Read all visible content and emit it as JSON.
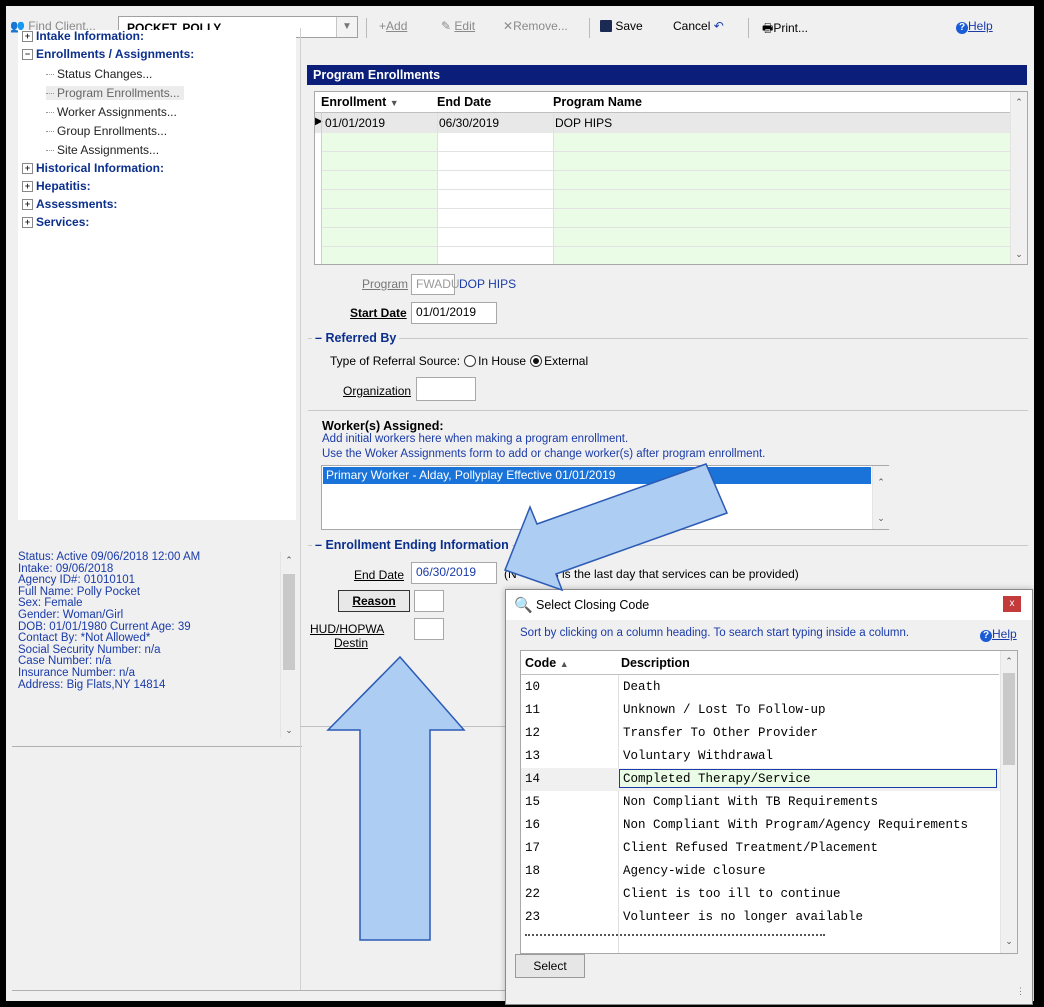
{
  "toolbar": {
    "find_client_label": "Find Client...",
    "client_name": "POCKET, POLLY",
    "add_label": "Add",
    "edit_label": "Edit",
    "remove_label": "Remove...",
    "save_label": "Save",
    "cancel_label": "Cancel",
    "print_label": "Print...",
    "help_label": "Help"
  },
  "tree": {
    "intake": "Intake Information:",
    "enrollments": "Enrollments / Assignments:",
    "children": [
      "Status Changes...",
      "Program Enrollments...",
      "Worker Assignments...",
      "Group Enrollments...",
      "Site Assignments..."
    ],
    "historical": "Historical Information:",
    "hepatitis": "Hepatitis:",
    "assessments": "Assessments:",
    "services": "Services:"
  },
  "client_info": [
    "Status: Active 09/06/2018 12:00 AM",
    "Intake: 09/06/2018",
    "Agency ID#: 01010101",
    "Full Name: Polly Pocket",
    "Sex: Female",
    "Gender: Woman/Girl",
    "DOB: 01/01/1980 Current Age: 39",
    "Contact By: *Not Allowed*",
    "Social Security Number: n/a",
    "Case Number: n/a",
    "Insurance Number: n/a",
    "Address: Big Flats,NY 14814"
  ],
  "program_enrollments": {
    "title": "Program Enrollments",
    "columns": [
      "Enrollment",
      "End Date",
      "Program Name"
    ],
    "rows": [
      {
        "enrollment": "01/01/2019",
        "end_date": "06/30/2019",
        "program": "DOP HIPS"
      }
    ]
  },
  "form": {
    "program_label": "Program",
    "program_code": "FWADU",
    "program_name": "DOP HIPS",
    "start_date_label": "Start Date",
    "start_date": "01/01/2019",
    "referred_by_title": "Referred By",
    "referral_source_label": "Type of Referral Source:",
    "in_house_label": "In House",
    "external_label": "External",
    "organization_label": "Organization",
    "workers_title": "Worker(s) Assigned:",
    "workers_note1": "Add initial workers here when making a program enrollment.",
    "workers_note2": "Use the Woker Assignments form to add or change worker(s) after program enrollment.",
    "worker_item": "Primary Worker - Alday, Pollyplay Effective 01/01/2019",
    "ending_title": "Enrollment Ending Information",
    "end_date_label": "End Date",
    "end_date": "06/30/2019",
    "end_date_note_left": "(N",
    "end_date_note_right": "is is the last day that services can be provided)",
    "reason_label": "Reason",
    "hud_label": "HUD/HOPWA",
    "destin_label": "Destin"
  },
  "dialog": {
    "title": "Select Closing Code",
    "instructions": "Sort by clicking on a column heading.   To search start typing  inside a column.",
    "help_label": "Help",
    "columns": [
      "Code",
      "Description"
    ],
    "rows": [
      {
        "code": "10",
        "desc": "Death"
      },
      {
        "code": "11",
        "desc": "Unknown / Lost To Follow-up"
      },
      {
        "code": "12",
        "desc": "Transfer To Other Provider"
      },
      {
        "code": "13",
        "desc": "Voluntary Withdrawal"
      },
      {
        "code": "14",
        "desc": "Completed Therapy/Service"
      },
      {
        "code": "15",
        "desc": "Non Compliant With TB Requirements"
      },
      {
        "code": "16",
        "desc": "Non Compliant With Program/Agency Requirements"
      },
      {
        "code": "17",
        "desc": "Client Refused Treatment/Placement"
      },
      {
        "code": "18",
        "desc": "Agency-wide closure"
      },
      {
        "code": "22",
        "desc": "Client is too ill to continue"
      },
      {
        "code": "23",
        "desc": "Volunteer is no longer available"
      }
    ],
    "select_label": "Select"
  },
  "colors": {
    "header_bar": "#0b1f7a",
    "selection": "#1a73d9",
    "tree_bold": "#0b2f8c",
    "info_text": "#1a3ba8",
    "arrow_fill": "#aecdf3"
  }
}
